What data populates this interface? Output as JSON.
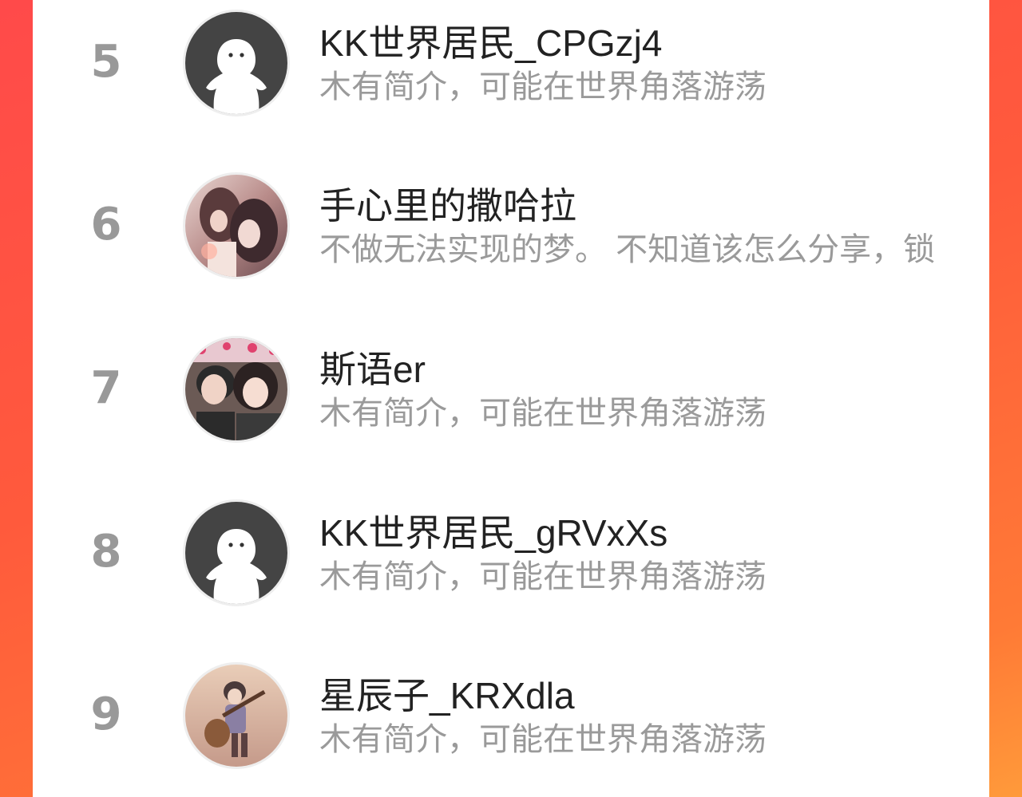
{
  "colors": {
    "background_start": "#ff4a4a",
    "background_end": "#ff9a3a",
    "rank": "#999999",
    "name": "#222222",
    "bio": "#9a9a9a"
  },
  "users": [
    {
      "rank": "5",
      "name": "KK世界居民_CPGzj4",
      "bio": "木有简介，可能在世界角落游荡",
      "avatar": "default-avatar-icon"
    },
    {
      "rank": "6",
      "name": "手心里的撒哈拉",
      "bio": "不做无法实现的梦。 不知道该怎么分享，锁",
      "avatar": "anime-couple-avatar"
    },
    {
      "rank": "7",
      "name": "斯语er",
      "bio": "木有简介，可能在世界角落游荡",
      "avatar": "couple-selfie-avatar"
    },
    {
      "rank": "8",
      "name": "KK世界居民_gRVxXs",
      "bio": "木有简介，可能在世界角落游荡",
      "avatar": "default-avatar-icon"
    },
    {
      "rank": "9",
      "name": "星辰子_KRXdla",
      "bio": "木有简介，可能在世界角落游荡",
      "avatar": "guitar-girl-avatar"
    }
  ]
}
